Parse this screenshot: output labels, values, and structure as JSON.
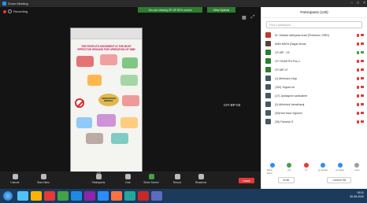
{
  "window": {
    "title": "Zoom Meeting"
  },
  "meeting": {
    "recording_label": "Recording",
    "talking_banner": "You are viewing ZP GP BP's screen",
    "view_options": "View Options",
    "speaker": "CFI-BP-03"
  },
  "shared_screen": {
    "title": "THE PEOPLE'S MOVEMENT IS THE MOST EFFECTIVE GROUND FOR OPERATION OF SBM",
    "hub": "OPERATION NIRMAL"
  },
  "toolbar": {
    "unmute": "Unmute",
    "start_video": "Start Video",
    "participants": "Participants",
    "participants_count": "129",
    "chat": "Chat",
    "share_screen": "Share Screen",
    "record": "Record",
    "reactions": "Reactions",
    "end": "Leave"
  },
  "panel": {
    "title": "Participants (129)",
    "search_placeholder": "Find a participant",
    "participants": [
      {
        "name": "Dr. Sahavir Adhiyaas Arab (Professor, SIRD)",
        "color": "#c0392b",
        "mic": "red",
        "cam": "red"
      },
      {
        "name": "AMN MAYA (Sagar Anna)",
        "color": "#5d4037",
        "mic": "red",
        "cam": "red"
      },
      {
        "name": "CFI-BP - 03",
        "color": "#2e7d32",
        "mic": "green",
        "cam": "green"
      },
      {
        "name": "CFI SHASTRI Pos-1",
        "color": "#2e7d32",
        "mic": "red",
        "cam": "red"
      },
      {
        "name": "CFI-BP-07",
        "color": "#2e7d32",
        "mic": "red",
        "cam": "red"
      },
      {
        "name": "(1) Abhinash Lilap",
        "color": "#455a64",
        "mic": "red",
        "cam": "red"
      },
      {
        "name": "(100) Yogesh.Ar",
        "color": "#455a64",
        "mic": "red",
        "cam": "red"
      },
      {
        "name": "(17) Jyotsapnin santuabhe",
        "color": "#455a64",
        "mic": "red",
        "cam": "red"
      },
      {
        "name": "(2) Abhishek Varadharaj",
        "color": "#455a64",
        "mic": "red",
        "cam": "red"
      },
      {
        "name": "(30)Hari Hara Vignesh",
        "color": "#455a64",
        "mic": "red",
        "cam": "red"
      },
      {
        "name": "(35) Pamesh S",
        "color": "#455a64",
        "mic": "red",
        "cam": "red"
      }
    ],
    "reactions": [
      {
        "label": "Raise Hand",
        "color": "#2d8cff"
      },
      {
        "label": "yes",
        "color": "#43a047"
      },
      {
        "label": "no",
        "color": "#e53935"
      },
      {
        "label": "go slower",
        "color": "#2d8cff"
      },
      {
        "label": "go faster",
        "color": "#2d8cff"
      },
      {
        "label": "more",
        "color": "#9e9e9e"
      }
    ],
    "invite": "Invite",
    "unmute_me": "Unmute Me"
  },
  "taskbar": {
    "time": "09:11",
    "date": "30-05-2020",
    "apps": [
      "#4fc3f7",
      "#ffb300",
      "#e53935",
      "#43a047",
      "#1e88e5",
      "#8e24aa",
      "#2d8cff",
      "#ff7043",
      "#26a69a",
      "#c62828",
      "#5c6bc0"
    ]
  }
}
